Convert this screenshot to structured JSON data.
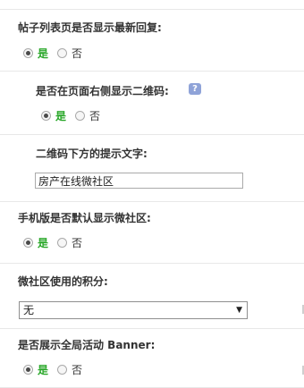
{
  "settings": {
    "latest_reply": {
      "label": "帖子列表页是否显示最新回复:",
      "yes": "是",
      "no": "否",
      "selected": "yes"
    },
    "qr_code": {
      "label": "是否在页面右侧显示二维码:",
      "help_icon": "?",
      "yes": "是",
      "no": "否",
      "selected": "yes"
    },
    "qr_hint": {
      "label": "二维码下方的提示文字:",
      "value": "房产在线微社区"
    },
    "mobile_default": {
      "label": "手机版是否默认显示微社区:",
      "yes": "是",
      "no": "否",
      "selected": "yes"
    },
    "credits": {
      "label": "微社区使用的积分:",
      "selected_option": "无"
    },
    "global_banner": {
      "label": "是否展示全局活动 Banner:",
      "yes": "是",
      "no": "否",
      "selected": "yes"
    }
  }
}
